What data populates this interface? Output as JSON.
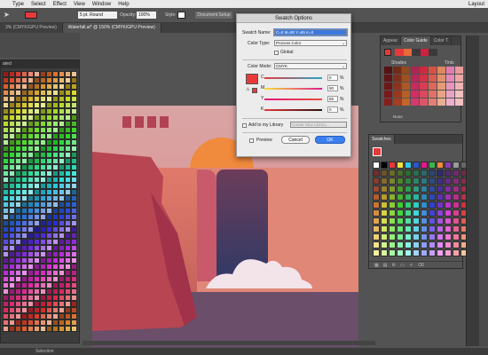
{
  "menu": {
    "items": [
      "Type",
      "Select",
      "Effect",
      "View",
      "Window",
      "Help"
    ],
    "right": "Layout"
  },
  "control": {
    "stroke_label": "5 pt. Round",
    "opacity_label": "Opacity:",
    "opacity_value": "100%",
    "style_label": "Style:",
    "doc_setup": "Document Setup"
  },
  "tabs": [
    {
      "label": "3% (CMYK/GPU Preview)"
    },
    {
      "label": "Waterfall.ai* @ 150% (CMYK/GPU Preview)"
    }
  ],
  "left_panel": {
    "title": "ated"
  },
  "status": {
    "text": "Selection"
  },
  "dialog": {
    "title": "Swatch Options",
    "swatch_name_label": "Swatch Name:",
    "swatch_name_value": "C=0 M=90 Y=85 K=0",
    "color_type_label": "Color Type:",
    "color_type_value": "Process Color",
    "global_label": "Global",
    "color_mode_label": "Color Mode:",
    "color_mode_value": "CMYK",
    "channels": [
      {
        "key": "C",
        "value": "0",
        "pct": "%",
        "color": "#35c7e8"
      },
      {
        "key": "M",
        "value": "90",
        "pct": "%",
        "color": "#e2198c"
      },
      {
        "key": "Y",
        "value": "85",
        "pct": "%",
        "color": "#f2e21a"
      },
      {
        "key": "K",
        "value": "0",
        "pct": "%",
        "color": "#222222"
      }
    ],
    "swatch_color": "#e8393a",
    "add_library_label": "Add to my Library",
    "library_placeholder": "Create New Library...",
    "preview_label": "Preview",
    "cancel_label": "Cancel",
    "ok_label": "OK"
  },
  "color_guide": {
    "tabs": [
      "Appear",
      "Color Guide",
      "Color T"
    ],
    "shades": "Shades",
    "tints": "Tints",
    "none_label": "None"
  },
  "swatches_panel": {
    "title": "Swatches"
  }
}
